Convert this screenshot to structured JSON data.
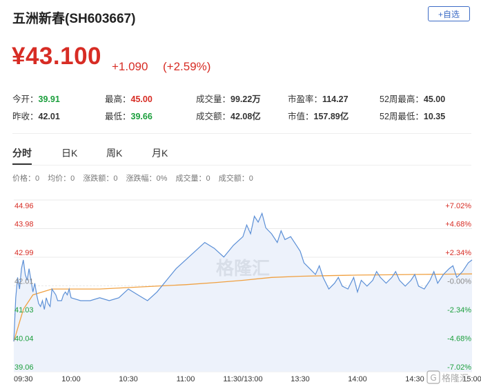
{
  "header": {
    "title": "五洲新春(SH603667)",
    "add_button": "+自选"
  },
  "quote": {
    "price": "¥43.100",
    "change": "+1.090",
    "change_pct": "(+2.59%)"
  },
  "stats": {
    "open_label": "今开：",
    "open": "39.91",
    "prev_close_label": "昨收：",
    "prev_close": "42.01",
    "high_label": "最高：",
    "high": "45.00",
    "low_label": "最低：",
    "low": "39.66",
    "volume_label": "成交量：",
    "volume": "99.22万",
    "amount_label": "成交额：",
    "amount": "42.08亿",
    "pe_label": "市盈率：",
    "pe": "114.27",
    "mcap_label": "市值：",
    "mcap": "157.89亿",
    "w52_high_label": "52周最高：",
    "w52_high": "45.00",
    "w52_low_label": "52周最低：",
    "w52_low": "10.35"
  },
  "tabs": [
    "分时",
    "日K",
    "周K",
    "月K"
  ],
  "info_bar": {
    "price": "价格：0",
    "avg": "均价：0",
    "chg_amt": "涨跌额：0",
    "chg_pct": "涨跌幅：0%",
    "volume": "成交量：0",
    "amount": "成交额：0"
  },
  "watermark": "格隆汇",
  "corner_logo": "格隆汇",
  "colors": {
    "up": "#d72c24",
    "down": "#1a9e3b",
    "line": "#5b8fd6",
    "avg": "#f0a040",
    "fill": "#edf2fb"
  },
  "chart_data": {
    "type": "line",
    "x_ticks": [
      "09:30",
      "10:00",
      "10:30",
      "11:00",
      "11:30/13:00",
      "13:30",
      "14:00",
      "14:30",
      "15:00"
    ],
    "y_left_ticks": [
      "44.96",
      "43.98",
      "42.99",
      "42.01",
      "41.03",
      "40.04",
      "39.06"
    ],
    "y_right_ticks": [
      "+7.02%",
      "+4.68%",
      "+2.34%",
      "-0.00%",
      "-2.34%",
      "-4.68%",
      "-7.02%"
    ],
    "ylim": [
      39.06,
      44.96
    ],
    "x_minutes": [
      0,
      240
    ],
    "series": [
      {
        "x": [
          0,
          1,
          2,
          3,
          4,
          5,
          6,
          7,
          8,
          9,
          10,
          11,
          12,
          13,
          14,
          15,
          16,
          17,
          18,
          19,
          20,
          21,
          22,
          23,
          24,
          25,
          26,
          27,
          28,
          29,
          30,
          35,
          40,
          45,
          50,
          55,
          60,
          65,
          70,
          75,
          80,
          85,
          90,
          95,
          100,
          105,
          110,
          115,
          120,
          122,
          124,
          126,
          128,
          130,
          132,
          135,
          138,
          140,
          142,
          145,
          148,
          150,
          152,
          155,
          158,
          160,
          162,
          165,
          168,
          170,
          172,
          175,
          178,
          180,
          182,
          185,
          188,
          190,
          192,
          195,
          198,
          200,
          202,
          205,
          208,
          210,
          212,
          215,
          218,
          220,
          222,
          225,
          228,
          230,
          232,
          235,
          238,
          240
        ],
        "values": [
          40.1,
          41.6,
          42.3,
          41.9,
          42.6,
          42.9,
          42.4,
          42.2,
          42.6,
          42.2,
          41.8,
          42.1,
          41.7,
          41.4,
          41.3,
          41.5,
          41.2,
          41.6,
          41.4,
          41.3,
          41.9,
          41.8,
          41.7,
          41.5,
          41.5,
          41.5,
          41.7,
          41.8,
          41.7,
          41.9,
          41.6,
          41.5,
          41.5,
          41.6,
          41.5,
          41.6,
          41.9,
          41.7,
          41.5,
          41.8,
          42.2,
          42.6,
          42.9,
          43.2,
          43.5,
          43.3,
          43.0,
          43.4,
          43.7,
          44.1,
          43.8,
          44.4,
          44.2,
          44.5,
          44.0,
          43.8,
          43.5,
          43.9,
          43.6,
          43.7,
          43.4,
          43.2,
          42.8,
          42.6,
          42.4,
          42.7,
          42.3,
          41.9,
          42.1,
          42.3,
          42.0,
          41.9,
          42.3,
          41.8,
          42.2,
          42.0,
          42.2,
          42.5,
          42.3,
          42.1,
          42.3,
          42.5,
          42.2,
          42.0,
          42.2,
          42.4,
          42.0,
          41.9,
          42.2,
          42.5,
          42.1,
          42.4,
          42.6,
          42.7,
          42.3,
          42.5,
          42.8,
          42.9
        ]
      },
      {
        "x": [
          0,
          5,
          10,
          15,
          20,
          30,
          45,
          60,
          75,
          90,
          105,
          120,
          135,
          150,
          165,
          180,
          195,
          210,
          225,
          240
        ],
        "values": [
          40.1,
          41.2,
          41.7,
          41.8,
          41.9,
          41.9,
          41.9,
          41.95,
          42.0,
          42.05,
          42.12,
          42.2,
          42.3,
          42.34,
          42.36,
          42.38,
          42.39,
          42.4,
          42.41,
          42.42
        ]
      }
    ]
  }
}
